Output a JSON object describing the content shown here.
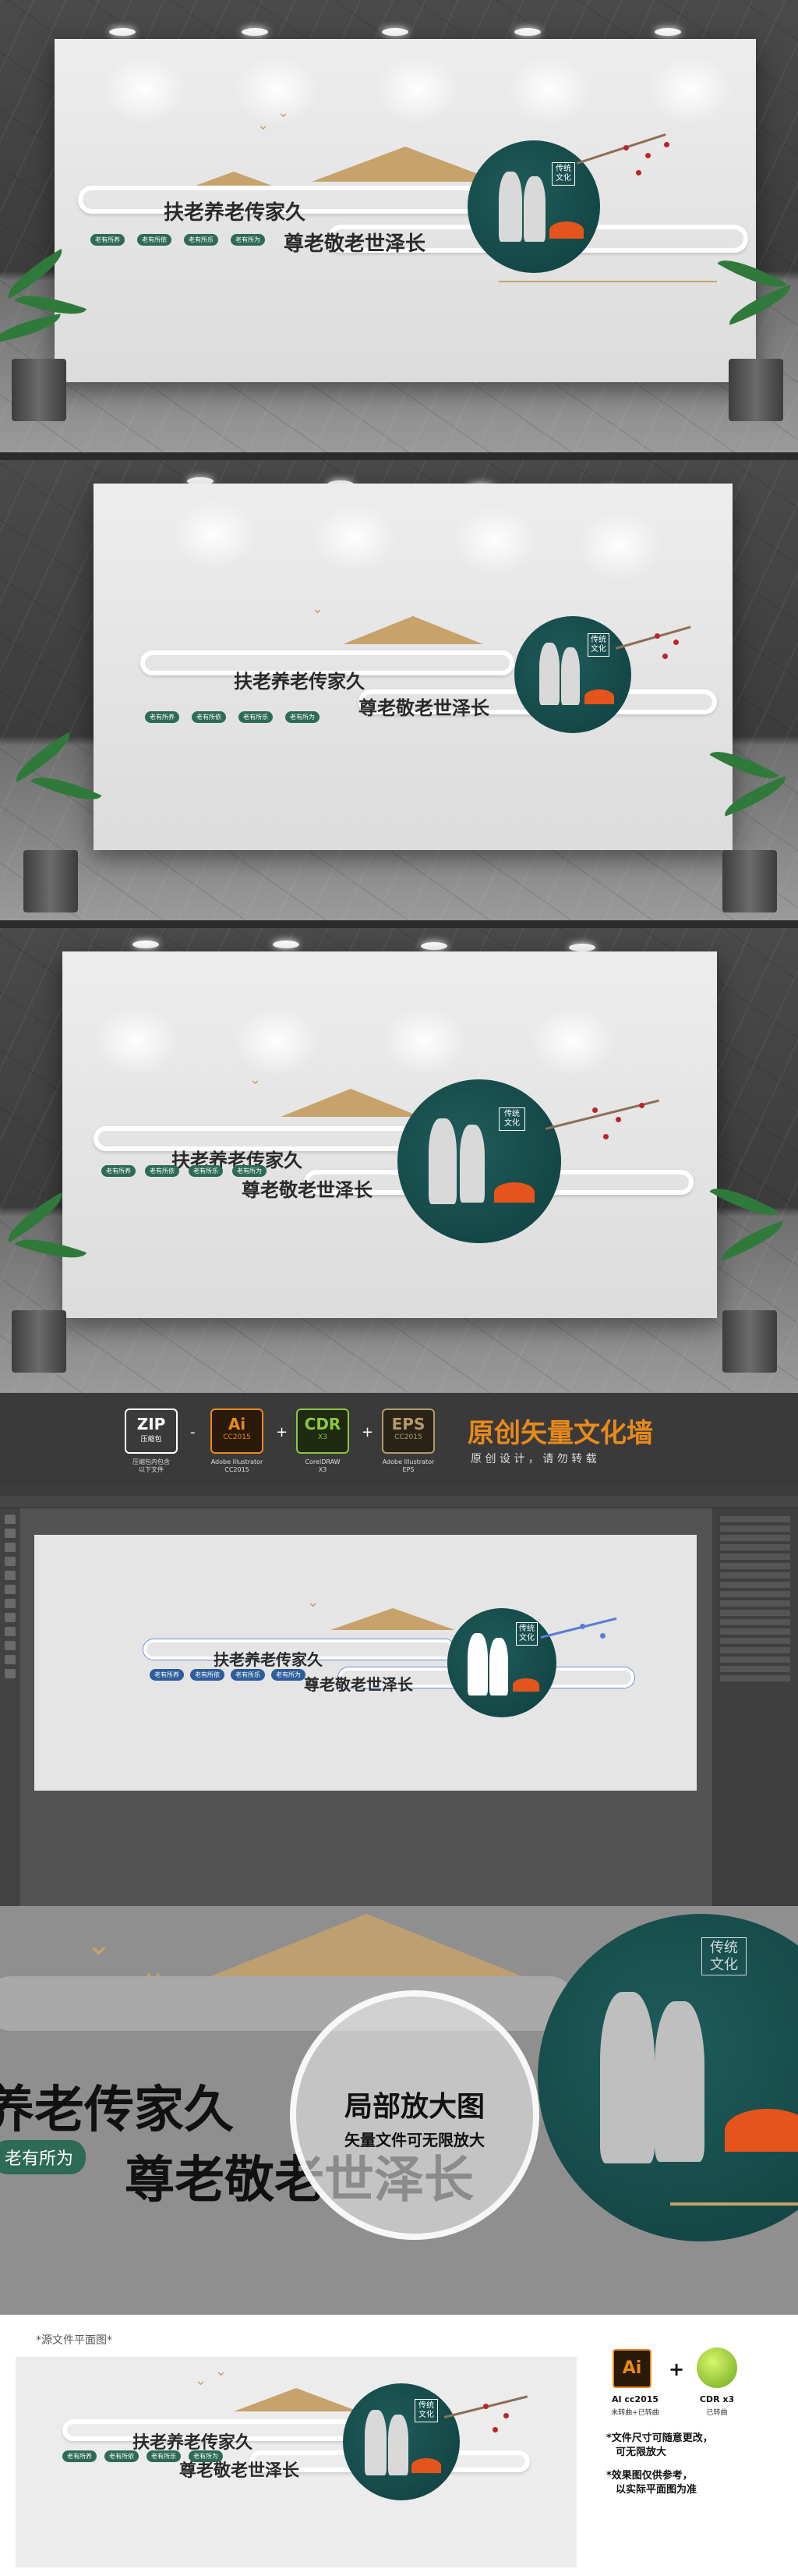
{
  "wall": {
    "title_line1": "扶老养老传家久",
    "title_line2": "尊老敬老世泽长",
    "badge": "传统文化",
    "pills": [
      "老有所养",
      "老有所依",
      "老有所乐",
      "老有所为"
    ]
  },
  "formats": {
    "zip": {
      "name": "ZIP",
      "sub": "压缩包",
      "caption": "压缩包内包含\n以下文件"
    },
    "ai": {
      "name": "Ai",
      "ver": "CC2015",
      "caption": "Adobe Illustrator\nCC2015"
    },
    "cdr": {
      "name": "CDR",
      "ver": "X3",
      "caption": "CorelDRAW\nX3"
    },
    "eps": {
      "name": "EPS",
      "ver": "CC2015",
      "caption": "Adobe Illustrator\nEPS"
    },
    "plus1": "+",
    "plus2": "+",
    "plus3": "+",
    "minus": "-",
    "headline": "原创矢量文化墙",
    "subline": "原 创 设 计 ， 请 勿 转 载"
  },
  "zoom": {
    "title": "局部放大图",
    "subtitle": "矢量文件可无限放大",
    "left_text": "养老传家久",
    "pill_text": "老有所为",
    "main_text": "尊老敬老世泽长",
    "badge": "传统文化"
  },
  "bottom": {
    "source_label": "*源文件平面图*",
    "ai_logo": "Ai",
    "ai_label": "AI cc2015",
    "ai_sub": "未转曲+已转曲",
    "plus": "+",
    "cdr_label": "CDR x3",
    "cdr_sub": "已转曲",
    "note1_line1": "*文件尺寸可随意更改，",
    "note1_line2": "可无限放大",
    "note2_line1": "*效果图仅供参考，",
    "note2_line2": "以实际平面图为准"
  },
  "colors": {
    "teal": "#0f3f3e",
    "gold": "#c7a26a",
    "sun": "#e5541c",
    "pill": "#2e6b55"
  }
}
